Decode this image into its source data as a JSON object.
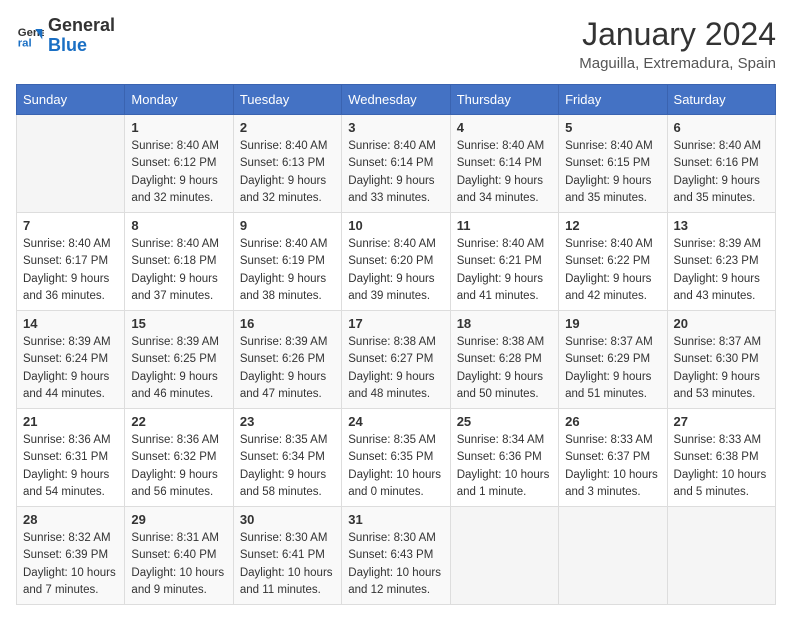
{
  "logo": {
    "line1": "General",
    "line2": "Blue"
  },
  "title": "January 2024",
  "subtitle": "Maguilla, Extremadura, Spain",
  "days_of_week": [
    "Sunday",
    "Monday",
    "Tuesday",
    "Wednesday",
    "Thursday",
    "Friday",
    "Saturday"
  ],
  "weeks": [
    [
      {
        "day": "",
        "detail": ""
      },
      {
        "day": "1",
        "detail": "Sunrise: 8:40 AM\nSunset: 6:12 PM\nDaylight: 9 hours\nand 32 minutes."
      },
      {
        "day": "2",
        "detail": "Sunrise: 8:40 AM\nSunset: 6:13 PM\nDaylight: 9 hours\nand 32 minutes."
      },
      {
        "day": "3",
        "detail": "Sunrise: 8:40 AM\nSunset: 6:14 PM\nDaylight: 9 hours\nand 33 minutes."
      },
      {
        "day": "4",
        "detail": "Sunrise: 8:40 AM\nSunset: 6:14 PM\nDaylight: 9 hours\nand 34 minutes."
      },
      {
        "day": "5",
        "detail": "Sunrise: 8:40 AM\nSunset: 6:15 PM\nDaylight: 9 hours\nand 35 minutes."
      },
      {
        "day": "6",
        "detail": "Sunrise: 8:40 AM\nSunset: 6:16 PM\nDaylight: 9 hours\nand 35 minutes."
      }
    ],
    [
      {
        "day": "7",
        "detail": "Sunrise: 8:40 AM\nSunset: 6:17 PM\nDaylight: 9 hours\nand 36 minutes."
      },
      {
        "day": "8",
        "detail": "Sunrise: 8:40 AM\nSunset: 6:18 PM\nDaylight: 9 hours\nand 37 minutes."
      },
      {
        "day": "9",
        "detail": "Sunrise: 8:40 AM\nSunset: 6:19 PM\nDaylight: 9 hours\nand 38 minutes."
      },
      {
        "day": "10",
        "detail": "Sunrise: 8:40 AM\nSunset: 6:20 PM\nDaylight: 9 hours\nand 39 minutes."
      },
      {
        "day": "11",
        "detail": "Sunrise: 8:40 AM\nSunset: 6:21 PM\nDaylight: 9 hours\nand 41 minutes."
      },
      {
        "day": "12",
        "detail": "Sunrise: 8:40 AM\nSunset: 6:22 PM\nDaylight: 9 hours\nand 42 minutes."
      },
      {
        "day": "13",
        "detail": "Sunrise: 8:39 AM\nSunset: 6:23 PM\nDaylight: 9 hours\nand 43 minutes."
      }
    ],
    [
      {
        "day": "14",
        "detail": "Sunrise: 8:39 AM\nSunset: 6:24 PM\nDaylight: 9 hours\nand 44 minutes."
      },
      {
        "day": "15",
        "detail": "Sunrise: 8:39 AM\nSunset: 6:25 PM\nDaylight: 9 hours\nand 46 minutes."
      },
      {
        "day": "16",
        "detail": "Sunrise: 8:39 AM\nSunset: 6:26 PM\nDaylight: 9 hours\nand 47 minutes."
      },
      {
        "day": "17",
        "detail": "Sunrise: 8:38 AM\nSunset: 6:27 PM\nDaylight: 9 hours\nand 48 minutes."
      },
      {
        "day": "18",
        "detail": "Sunrise: 8:38 AM\nSunset: 6:28 PM\nDaylight: 9 hours\nand 50 minutes."
      },
      {
        "day": "19",
        "detail": "Sunrise: 8:37 AM\nSunset: 6:29 PM\nDaylight: 9 hours\nand 51 minutes."
      },
      {
        "day": "20",
        "detail": "Sunrise: 8:37 AM\nSunset: 6:30 PM\nDaylight: 9 hours\nand 53 minutes."
      }
    ],
    [
      {
        "day": "21",
        "detail": "Sunrise: 8:36 AM\nSunset: 6:31 PM\nDaylight: 9 hours\nand 54 minutes."
      },
      {
        "day": "22",
        "detail": "Sunrise: 8:36 AM\nSunset: 6:32 PM\nDaylight: 9 hours\nand 56 minutes."
      },
      {
        "day": "23",
        "detail": "Sunrise: 8:35 AM\nSunset: 6:34 PM\nDaylight: 9 hours\nand 58 minutes."
      },
      {
        "day": "24",
        "detail": "Sunrise: 8:35 AM\nSunset: 6:35 PM\nDaylight: 10 hours\nand 0 minutes."
      },
      {
        "day": "25",
        "detail": "Sunrise: 8:34 AM\nSunset: 6:36 PM\nDaylight: 10 hours\nand 1 minute."
      },
      {
        "day": "26",
        "detail": "Sunrise: 8:33 AM\nSunset: 6:37 PM\nDaylight: 10 hours\nand 3 minutes."
      },
      {
        "day": "27",
        "detail": "Sunrise: 8:33 AM\nSunset: 6:38 PM\nDaylight: 10 hours\nand 5 minutes."
      }
    ],
    [
      {
        "day": "28",
        "detail": "Sunrise: 8:32 AM\nSunset: 6:39 PM\nDaylight: 10 hours\nand 7 minutes."
      },
      {
        "day": "29",
        "detail": "Sunrise: 8:31 AM\nSunset: 6:40 PM\nDaylight: 10 hours\nand 9 minutes."
      },
      {
        "day": "30",
        "detail": "Sunrise: 8:30 AM\nSunset: 6:41 PM\nDaylight: 10 hours\nand 11 minutes."
      },
      {
        "day": "31",
        "detail": "Sunrise: 8:30 AM\nSunset: 6:43 PM\nDaylight: 10 hours\nand 12 minutes."
      },
      {
        "day": "",
        "detail": ""
      },
      {
        "day": "",
        "detail": ""
      },
      {
        "day": "",
        "detail": ""
      }
    ]
  ]
}
